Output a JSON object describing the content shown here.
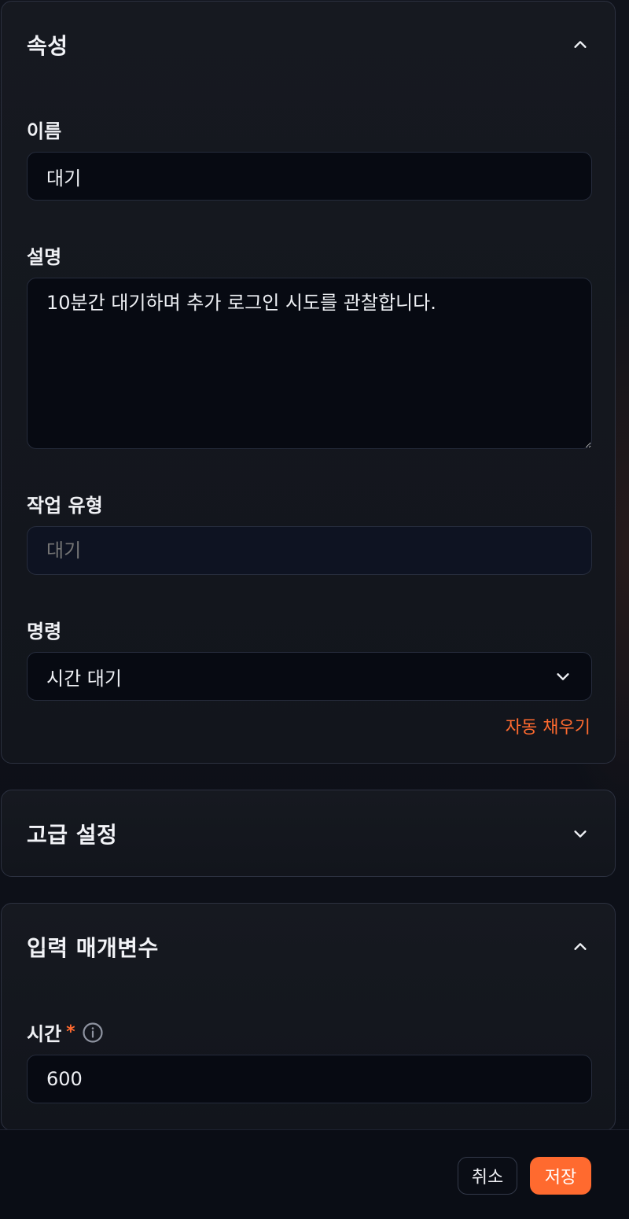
{
  "properties": {
    "title": "속성",
    "name_label": "이름",
    "name_value": "대기",
    "description_label": "설명",
    "description_value": "10분간 대기하며 추가 로그인 시도를 관찰합니다.",
    "action_type_label": "작업 유형",
    "action_type_placeholder": "대기",
    "command_label": "명령",
    "command_value": "시간 대기",
    "autofill_label": "자동 채우기"
  },
  "advanced": {
    "title": "고급 설정"
  },
  "input_params": {
    "title": "입력 매개변수",
    "time_label": "시간",
    "required_mark": "*",
    "time_value": "600"
  },
  "footer": {
    "cancel_label": "취소",
    "save_label": "저장"
  },
  "icons": {
    "collapse": "chevron-up-icon",
    "expand": "chevron-down-icon",
    "info": "info-icon"
  },
  "colors": {
    "accent": "#ff6a2f",
    "background": "#0b0e16",
    "panel": "#161920",
    "field": "#070a12"
  }
}
